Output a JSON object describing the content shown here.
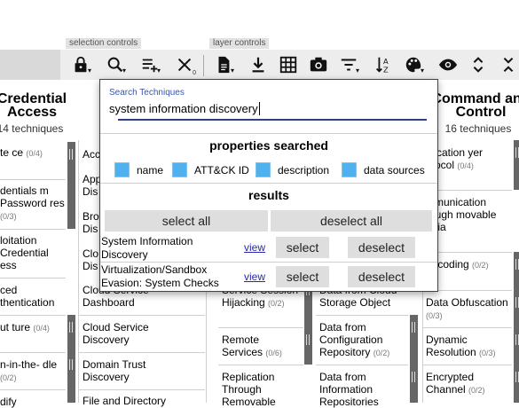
{
  "toolbar": {
    "selection_controls_label": "selection controls",
    "layer_controls_label": "layer controls",
    "icons": [
      "lock-icon",
      "search-icon",
      "multiselect-icon",
      "deselect-icon",
      "export-icon",
      "download-icon",
      "layout-icon",
      "camera-icon",
      "filter-icon",
      "sort-icon",
      "color-icon",
      "eye-icon",
      "expand-icon",
      "collapse-icon"
    ],
    "deselect_count": "0"
  },
  "matrix": {
    "columns": [
      {
        "title": "Credential Access",
        "subtitle": "14 techniques"
      },
      {
        "title": "Command and Control",
        "subtitle": "16 techniques"
      }
    ],
    "left_cells": [
      {
        "text": "te ce",
        "count": "(0/4)"
      },
      {
        "text": "dentials m Password res",
        "count": "(0/3)"
      },
      {
        "text": "loitation Credential ess",
        "count": ""
      },
      {
        "text": "ced thentication",
        "count": ""
      },
      {
        "text": "ut ture",
        "count": "(0/4)"
      },
      {
        "text": "n-in-the- dle",
        "count": "(0/2)"
      },
      {
        "text": "dify",
        "count": ""
      }
    ],
    "col2_cells": [
      {
        "text": "Acc"
      },
      {
        "text": "App Dis"
      },
      {
        "text": "Bro Dis"
      },
      {
        "text": "Clo Dis"
      },
      {
        "text": "Cloud Service Dashboard"
      },
      {
        "text": "Cloud Service Discovery"
      },
      {
        "text": "Domain Trust Discovery"
      },
      {
        "text": "File and Directory"
      }
    ],
    "col3_cells": [
      {
        "text": "Service Session Hijacking",
        "count": "(0/2)"
      },
      {
        "text": "Remote Services",
        "count": "(0/6)"
      },
      {
        "text": "Replication Through Removable",
        "count": ""
      }
    ],
    "col4_cells": [
      {
        "text": "Data from Cloud Storage Object",
        "count": ""
      },
      {
        "text": "Data from Configuration Repository",
        "count": "(0/2)"
      },
      {
        "text": "Data from Information Repositories",
        "count": ""
      }
    ],
    "right_cells": [
      {
        "text": "plication yer otocol",
        "count": "(0/4)"
      },
      {
        "text": "mmunication rough movable edia",
        "count": ""
      },
      {
        "text": "ta coding",
        "count": "(0/2)"
      },
      {
        "text": "Data Obfuscation",
        "count": "(0/3)"
      },
      {
        "text": "Dynamic Resolution",
        "count": "(0/3)"
      },
      {
        "text": "Encrypted Channel",
        "count": "(0/2)"
      }
    ]
  },
  "search_popover": {
    "label": "Search Techniques",
    "query": "system information discovery",
    "properties_title": "properties searched",
    "properties": [
      "name",
      "ATT&CK ID",
      "description",
      "data sources"
    ],
    "results_title": "results",
    "select_all": "select all",
    "deselect_all": "deselect all",
    "results": [
      {
        "name": "System Information Discovery",
        "view": "view",
        "select": "select",
        "deselect": "deselect"
      },
      {
        "name": "Virtualization/Sandbox Evasion: System Checks",
        "view": "view",
        "select": "select",
        "deselect": "deselect"
      }
    ]
  },
  "colors": {
    "checkbox": "#4fb2ef",
    "link": "#2a2aa8",
    "underline": "#2e3f88"
  }
}
